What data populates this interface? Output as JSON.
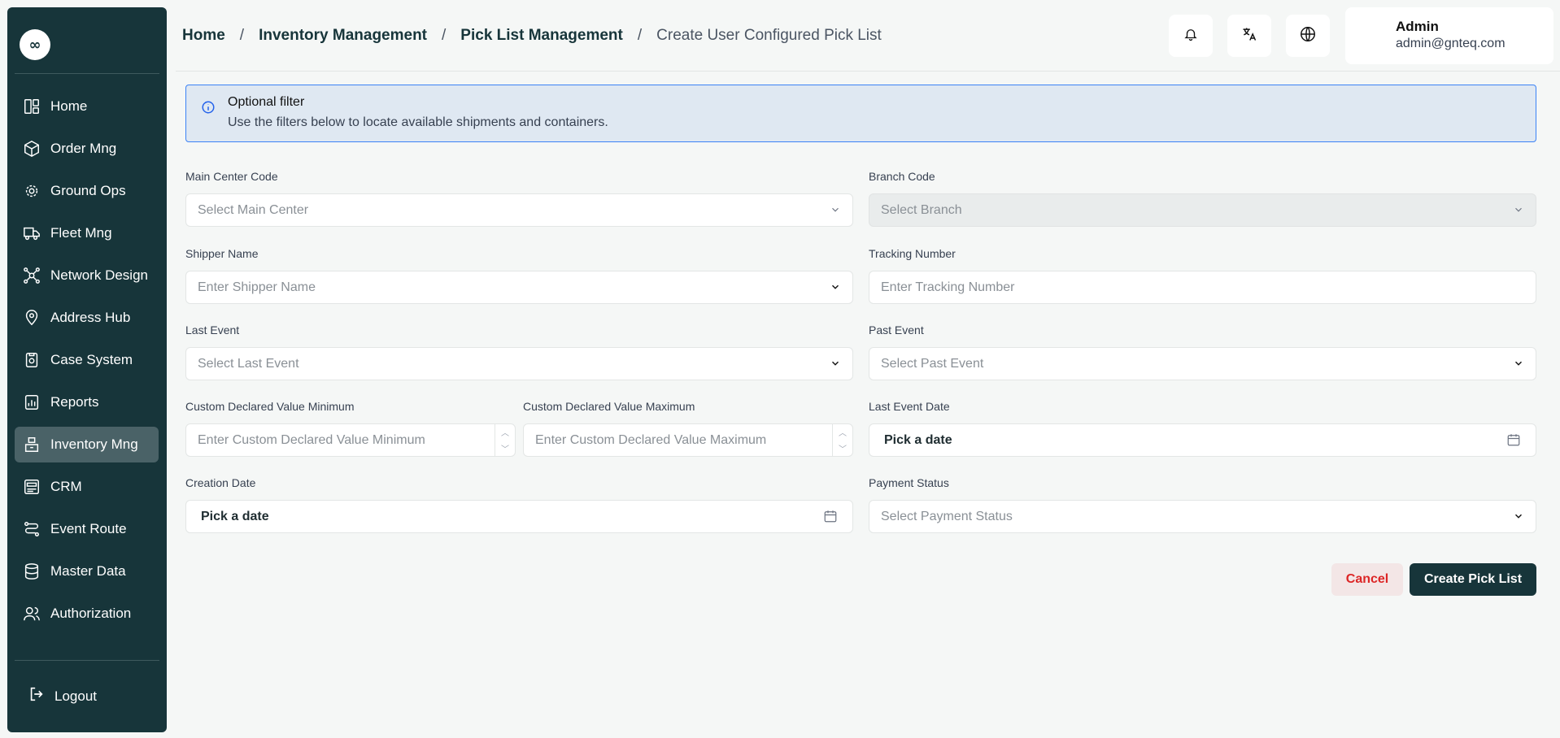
{
  "sidebar": {
    "logo_glyph": "∞",
    "items": [
      {
        "label": "Home",
        "icon": "home-grid-icon"
      },
      {
        "label": "Order Mng",
        "icon": "box-icon"
      },
      {
        "label": "Ground Ops",
        "icon": "gear-icon"
      },
      {
        "label": "Fleet Mng",
        "icon": "truck-icon"
      },
      {
        "label": "Network Design",
        "icon": "network-icon"
      },
      {
        "label": "Address Hub",
        "icon": "location-pin-icon"
      },
      {
        "label": "Case System",
        "icon": "case-icon"
      },
      {
        "label": "Reports",
        "icon": "report-icon"
      },
      {
        "label": "Inventory Mng",
        "icon": "inventory-icon",
        "active": true
      },
      {
        "label": "CRM",
        "icon": "crm-icon"
      },
      {
        "label": "Event Route",
        "icon": "route-icon"
      },
      {
        "label": "Master Data",
        "icon": "database-icon"
      },
      {
        "label": "Authorization",
        "icon": "users-icon"
      }
    ],
    "logout_label": "Logout"
  },
  "header": {
    "breadcrumbs": [
      "Home",
      "Inventory Management",
      "Pick List Management",
      "Create User Configured Pick List"
    ],
    "separator": "/",
    "user": {
      "name": "Admin",
      "email": "admin@gnteq.com"
    }
  },
  "banner": {
    "title": "Optional filter",
    "description": "Use the filters below to locate available shipments and containers."
  },
  "form": {
    "main_center": {
      "label": "Main Center Code",
      "placeholder": "Select Main Center"
    },
    "branch": {
      "label": "Branch Code",
      "placeholder": "Select Branch"
    },
    "shipper": {
      "label": "Shipper Name",
      "placeholder": "Enter Shipper Name"
    },
    "tracking": {
      "label": "Tracking Number",
      "placeholder": "Enter Tracking Number"
    },
    "last_event": {
      "label": "Last Event",
      "placeholder": "Select Last Event"
    },
    "past_event": {
      "label": "Past Event",
      "placeholder": "Select Past Event"
    },
    "cdv_min": {
      "label": "Custom Declared Value Minimum",
      "placeholder": "Enter Custom Declared Value Minimum"
    },
    "cdv_max": {
      "label": "Custom Declared Value Maximum",
      "placeholder": "Enter Custom Declared Value Maximum"
    },
    "last_event_date": {
      "label": "Last Event Date",
      "value": "Pick a date"
    },
    "creation_date": {
      "label": "Creation Date",
      "value": "Pick a date"
    },
    "payment_status": {
      "label": "Payment Status",
      "placeholder": "Select Payment Status"
    }
  },
  "actions": {
    "cancel": "Cancel",
    "create": "Create Pick List"
  },
  "colors": {
    "sidebar_bg": "#17353a",
    "accent": "#17353a",
    "cancel_text": "#dc2626",
    "banner_border": "#3b82f6"
  }
}
